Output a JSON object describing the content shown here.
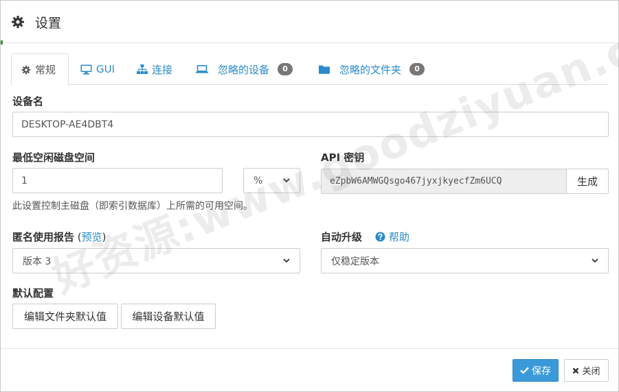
{
  "dialog": {
    "title": "设置"
  },
  "tabs": [
    {
      "label": "常规",
      "icon": "gear-icon"
    },
    {
      "label": "GUI",
      "icon": "monitor-icon"
    },
    {
      "label": "连接",
      "icon": "sitemap-icon"
    },
    {
      "label": "忽略的设备",
      "icon": "laptop-icon",
      "badge": "0"
    },
    {
      "label": "忽略的文件夹",
      "icon": "folder-icon",
      "badge": "0"
    }
  ],
  "device_name": {
    "label": "设备名",
    "value": "DESKTOP-AE4DBT4"
  },
  "min_disk_space": {
    "label": "最低空闲磁盘空间",
    "value": "1",
    "unit": "%",
    "help": "此设置控制主磁盘（即索引数据库）上所需的可用空间。"
  },
  "api_key": {
    "label": "API 密钥",
    "value": "eZpbW6AMWGQsgo467jyxjkyecfZm6UCQ",
    "generate_label": "生成"
  },
  "usage_report": {
    "label": "匿名使用报告",
    "paren_open": " (",
    "preview_link": "预览",
    "paren_close": ")",
    "value": "版本 3"
  },
  "auto_upgrade": {
    "label": "自动升级",
    "help_link": "帮助",
    "value": "仅稳定版本"
  },
  "defaults": {
    "label": "默认配置",
    "edit_folder_label": "编辑文件夹默认值",
    "edit_device_label": "编辑设备默认值"
  },
  "footer": {
    "save_label": "保存",
    "close_label": "关闭"
  },
  "watermark": {
    "text": "好资源:www.goodziyuan.com"
  },
  "colors": {
    "accent": "#3a9ad9",
    "link": "#2a8bcc",
    "badge": "#777777"
  }
}
